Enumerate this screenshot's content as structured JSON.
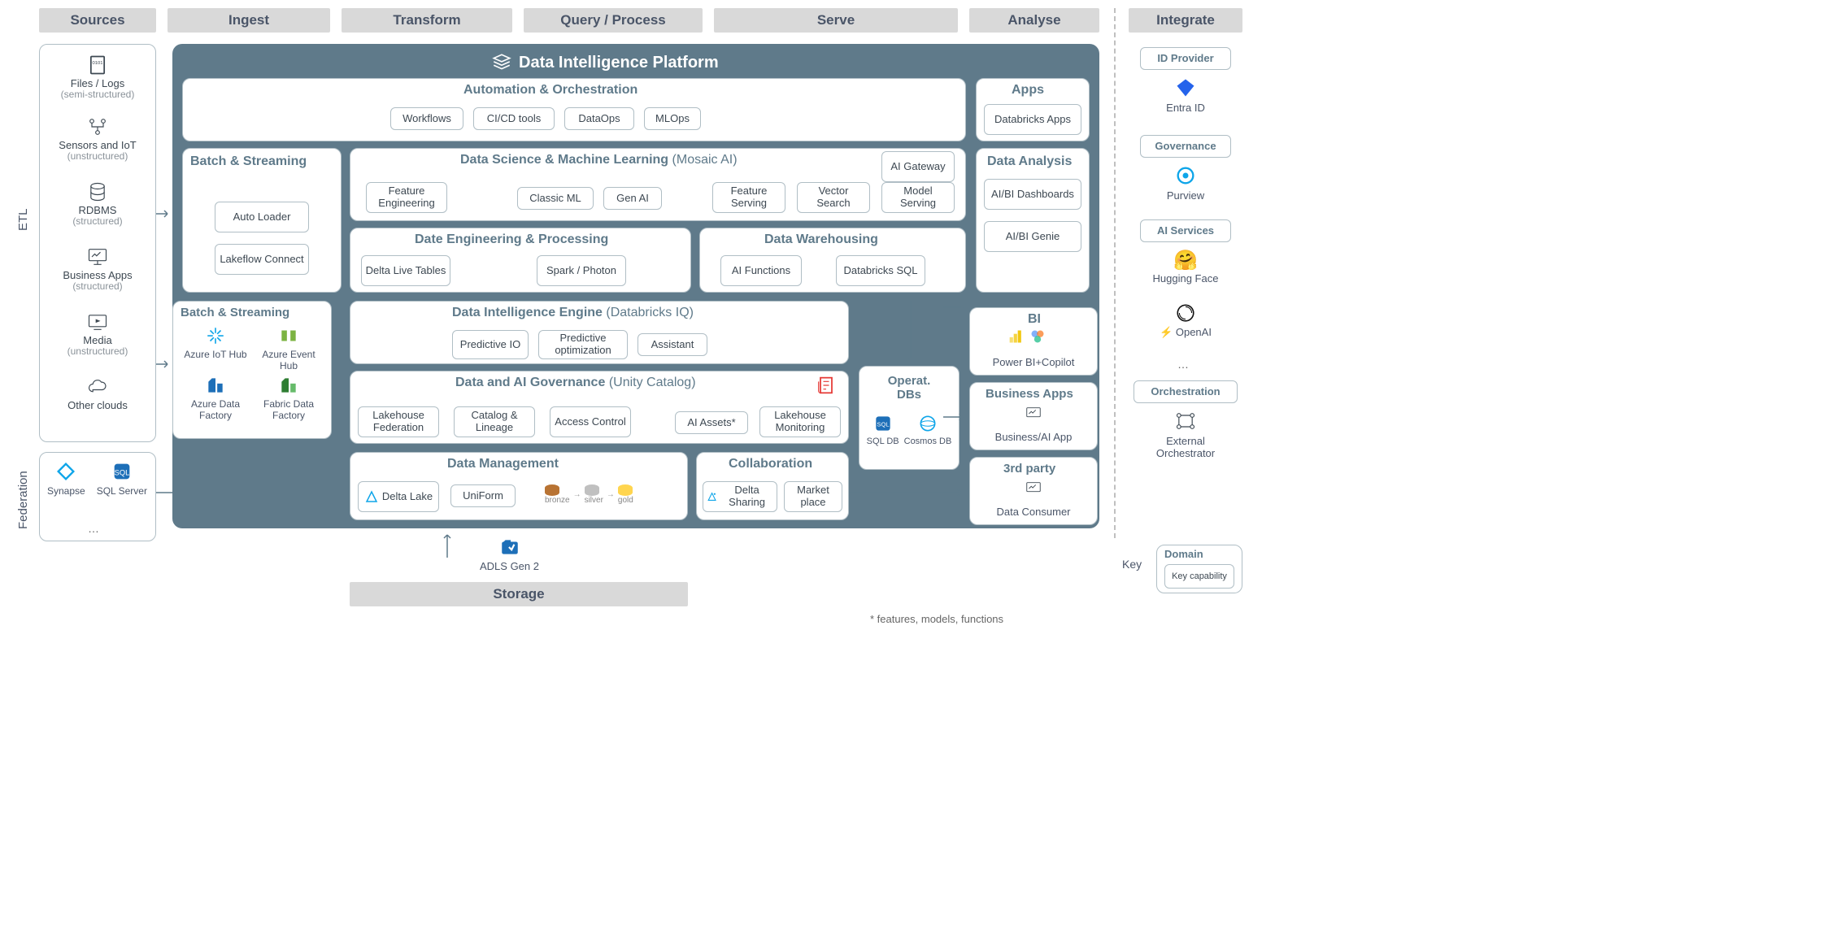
{
  "columns": {
    "sources": "Sources",
    "ingest": "Ingest",
    "transform": "Transform",
    "query": "Query / Process",
    "serve": "Serve",
    "analyse": "Analyse",
    "integrate": "Integrate"
  },
  "row_labels": {
    "etl": "ETL",
    "federation": "Federation"
  },
  "sources": {
    "files": {
      "label": "Files / Logs",
      "sub": "(semi-structured)"
    },
    "sensors": {
      "label": "Sensors and IoT",
      "sub": "(unstructured)"
    },
    "rdbms": {
      "label": "RDBMS",
      "sub": "(structured)"
    },
    "bizapps": {
      "label": "Business Apps",
      "sub": "(structured)"
    },
    "media": {
      "label": "Media",
      "sub": "(unstructured)"
    },
    "otherclouds": {
      "label": "Other clouds",
      "sub": ""
    }
  },
  "federation_sources": {
    "synapse": "Synapse",
    "sqlserver": "SQL Server",
    "more": "…"
  },
  "platform_title": "Data Intelligence Platform",
  "automation": {
    "title": "Automation & Orchestration",
    "workflows": "Workflows",
    "cicd": "CI/CD tools",
    "dataops": "DataOps",
    "mlops": "MLOps"
  },
  "apps": {
    "title": "Apps",
    "databricks_apps": "Databricks Apps"
  },
  "batch_streaming_inner": {
    "title": "Batch & Streaming",
    "autoloader": "Auto Loader",
    "lakeflow": "Lakeflow Connect"
  },
  "dsml": {
    "title": "Data Science & Machine Learning",
    "suffix": "(Mosaic AI)",
    "feature_eng": "Feature Engineering",
    "classic_ml": "Classic ML",
    "gen_ai": "Gen AI",
    "feature_serving": "Feature Serving",
    "vector_search": "Vector Search",
    "model_serving": "Model Serving",
    "ai_gateway": "AI Gateway"
  },
  "data_analysis": {
    "title": "Data Analysis",
    "dashboards": "AI/BI Dashboards",
    "genie": "AI/BI Genie"
  },
  "de_processing": {
    "title": "Date Engineering & Processing",
    "dlt": "Delta Live Tables",
    "spark": "Spark / Photon"
  },
  "warehousing": {
    "title": "Data Warehousing",
    "ai_functions": "AI Functions",
    "dbsql": "Databricks SQL"
  },
  "batch_streaming_azure": {
    "title": "Batch & Streaming",
    "iothub": "Azure IoT Hub",
    "eventhub": "Azure Event Hub",
    "adf": "Azure Data Factory",
    "fabric": "Fabric Data Factory"
  },
  "engine": {
    "title": "Data Intelligence Engine",
    "suffix": "(Databricks IQ)",
    "predictive_io": "Predictive IO",
    "predictive_opt": "Predictive optimization",
    "assistant": "Assistant"
  },
  "governance": {
    "title": "Data and AI Governance",
    "suffix": "(Unity Catalog)",
    "federation": "Lakehouse Federation",
    "catalog": "Catalog & Lineage",
    "access": "Access Control",
    "ai_assets": "AI Assets*",
    "monitoring": "Lakehouse Monitoring"
  },
  "opdbs": {
    "title": "Operat. DBs",
    "sqldb": "SQL DB",
    "cosmos": "Cosmos DB"
  },
  "bi": {
    "title": "BI",
    "powerbi": "Power BI+Copilot"
  },
  "bizapps_out": {
    "title": "Business Apps",
    "app": "Business/AI App"
  },
  "thirdparty": {
    "title": "3rd party",
    "consumer": "Data Consumer"
  },
  "data_mgmt": {
    "title": "Data Management",
    "delta_lake": "Delta Lake",
    "uniform": "UniForm",
    "bronze": "bronze",
    "silver": "silver",
    "gold": "gold"
  },
  "collab": {
    "title": "Collaboration",
    "sharing": "Delta Sharing",
    "marketplace": "Market place"
  },
  "storage": {
    "adls": "ADLS Gen 2",
    "label": "Storage"
  },
  "integrate": {
    "id_provider": "ID Provider",
    "entra": "Entra ID",
    "governance": "Governance",
    "purview": "Purview",
    "ai_services": "AI Services",
    "hf": "Hugging Face",
    "openai": "OpenAI",
    "more": "…",
    "orchestration": "Orchestration",
    "external": "External Orchestrator"
  },
  "footnote": "* features, models, functions",
  "key": {
    "label": "Key",
    "domain": "Domain",
    "capability": "Key capability"
  }
}
